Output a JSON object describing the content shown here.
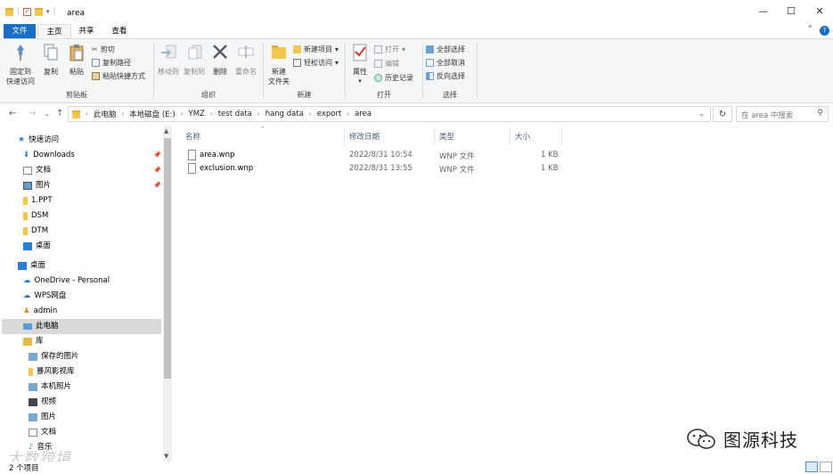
{
  "window": {
    "title": "area",
    "minimize": "—",
    "maximize": "☐",
    "close": "✕"
  },
  "tabs": {
    "file": "文件",
    "home": "主页",
    "share": "共享",
    "view": "查看"
  },
  "ribbon": {
    "clipboard": {
      "label": "剪贴板",
      "pin": "固定到\n快速访问",
      "pin_l1": "固定到",
      "pin_l2": "快速访问",
      "copy": "复制",
      "paste": "粘贴",
      "cut": "剪切",
      "copy_path": "复制路径",
      "paste_shortcut": "粘贴快捷方式"
    },
    "organize": {
      "label": "组织",
      "move_to": "移动到",
      "copy_to": "复制到",
      "delete": "删除",
      "rename": "重命名"
    },
    "new": {
      "label": "新建",
      "new_folder_l1": "新建",
      "new_folder_l2": "文件夹",
      "new_item": "新建项目",
      "easy_access": "轻松访问"
    },
    "open": {
      "label": "打开",
      "properties": "属性",
      "open": "打开",
      "edit": "编辑",
      "history": "历史记录"
    },
    "select": {
      "label": "选择",
      "select_all": "全部选择",
      "select_none": "全部取消",
      "invert": "反向选择"
    }
  },
  "address": {
    "crumbs": [
      "此电脑",
      "本地磁盘 (E:)",
      "YMZ",
      "test data",
      "hang data",
      "export",
      "area"
    ],
    "search_placeholder": "在 area 中搜索"
  },
  "nav": {
    "quick_access": "快速访问",
    "items": [
      "Downloads",
      "文档",
      "图片",
      "1.PPT",
      "DSM",
      "DTM",
      "桌面"
    ],
    "desktop": "桌面",
    "onedrive": "OneDrive - Personal",
    "wps": "WPS网盘",
    "admin": "admin",
    "this_pc": "此电脑",
    "library": "库",
    "lib_items": [
      "保存的图片",
      "暴风影视库",
      "本机照片",
      "视频",
      "图片",
      "文档",
      "音乐"
    ]
  },
  "columns": {
    "name": "名称",
    "date": "修改日期",
    "type": "类型",
    "size": "大小"
  },
  "files": [
    {
      "name": "area.wnp",
      "date": "2022/8/31 10:54",
      "type": "WNP 文件",
      "size": "1 KB"
    },
    {
      "name": "exclusion.wnp",
      "date": "2022/8/31 13:55",
      "type": "WNP 文件",
      "size": "1 KB"
    }
  ],
  "status": {
    "count": "2 个项目"
  },
  "watermark": {
    "brand": "图源科技",
    "corner": "大数跨境"
  },
  "colors": {
    "accent": "#1a6fc4",
    "folder": "#f3c74f",
    "selected": "#d9d9d9"
  }
}
